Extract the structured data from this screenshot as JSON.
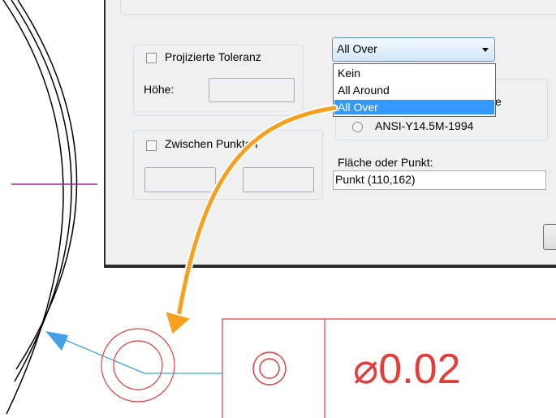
{
  "dialog": {
    "projected_tolerance": {
      "label": "Projizierte Toleranz",
      "height_label": "Höhe:"
    },
    "between_points": {
      "label": "Zwischen Punkten"
    },
    "scope_combo": {
      "selected": "All Over",
      "options": [
        "Kein",
        "All Around",
        "All Over"
      ],
      "highlighted_option": "All Over"
    },
    "standard_partial_label": "e",
    "standard_option": "ANSI-Y14.5M-1994",
    "face_or_point": {
      "label": "Fläche oder Punkt:",
      "value": "Punkt (110,162)"
    }
  },
  "drawing": {
    "tolerance_value": "⌀0.02",
    "colors": {
      "cad_red": "#e53c3c",
      "leader_blue": "#41a0e6",
      "centerline_purple": "#a020a0",
      "callout_orange": "#f5a01e"
    }
  }
}
